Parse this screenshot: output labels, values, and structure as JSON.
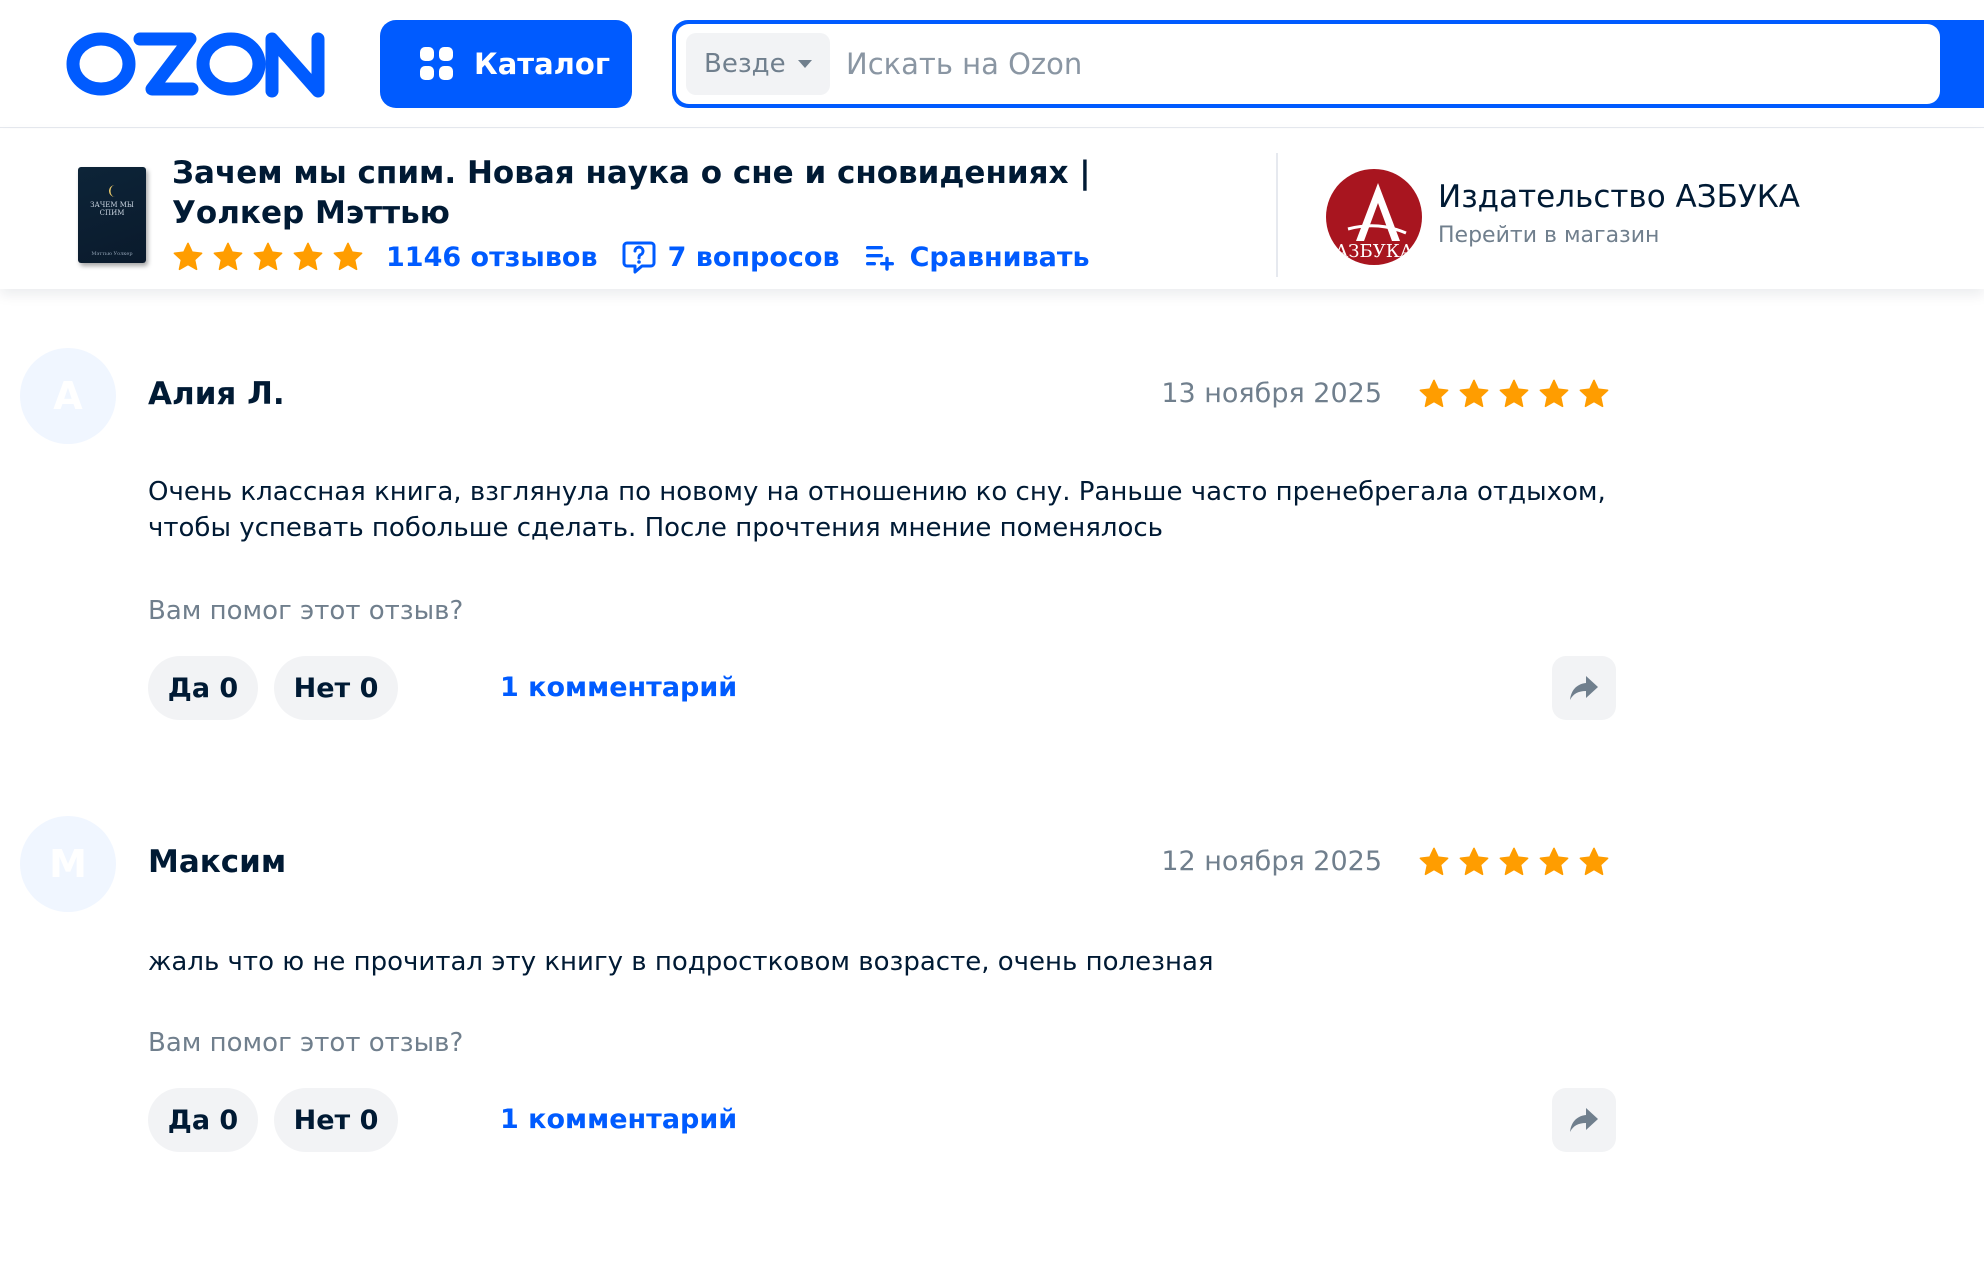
{
  "header": {
    "logo_text": "OZON",
    "catalog_label": "Каталог",
    "search_scope": "Везде",
    "search_placeholder": "Искать на Ozon",
    "brand_color": "#005bff"
  },
  "product": {
    "title": "Зачем мы спим. Новая наука о сне и сновидениях | Уолкер Мэттью",
    "cover_title": "ЗАЧЕМ МЫ СПИМ",
    "cover_author": "Мэттью Уолкер",
    "rating_stars": 5,
    "reviews_label": "1146 отзывов",
    "questions_label": "7 вопросов",
    "compare_label": "Сравнивать",
    "icons": [
      "star-icon",
      "question-bubble-icon",
      "compare-list-icon"
    ]
  },
  "seller": {
    "name": "Издательство АЗБУКА",
    "link": "Перейти в магазин",
    "logo_text": "АЗБУКА",
    "logo_color": "#a8151f"
  },
  "reviews": [
    {
      "avatar_letter": "А",
      "author": "Алия Л.",
      "date": "13 ноября 2025",
      "rating": 5,
      "text": "Очень классная книга, взглянула по новому на отношению ко сну. Раньше часто пренебрегала отдыхом, чтобы успевать побольше сделать. После прочтения мнение поменялось",
      "helpful_question": "Вам помог этот отзыв?",
      "yes_label": "Да 0",
      "no_label": "Нет 0",
      "comments_label": "1 комментарий"
    },
    {
      "avatar_letter": "М",
      "author": "Максим",
      "date": "12 ноября 2025",
      "rating": 5,
      "text": "жаль что ю не прочитал эту книгу в подростковом возрасте, очень полезная",
      "helpful_question": "Вам помог этот отзыв?",
      "yes_label": "Да 0",
      "no_label": "Нет 0",
      "comments_label": "1 комментарий"
    }
  ],
  "colors": {
    "star": "#ff9d00",
    "link": "#005bff",
    "muted": "#707f8d"
  }
}
